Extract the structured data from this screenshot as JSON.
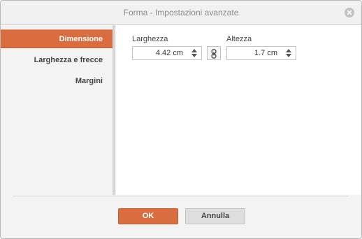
{
  "dialog": {
    "title": "Forma - Impostazioni avanzate"
  },
  "sidebar": {
    "items": [
      {
        "label": "Dimensione",
        "active": true
      },
      {
        "label": "Larghezza e frecce",
        "active": false
      },
      {
        "label": "Margini",
        "active": false
      }
    ]
  },
  "size": {
    "width_label": "Larghezza",
    "width_value": "4.42 cm",
    "height_label": "Altezza",
    "height_value": "1.7 cm",
    "aspect_lock_icon": "chain-link-icon"
  },
  "footer": {
    "ok_label": "OK",
    "cancel_label": "Annulla"
  },
  "colors": {
    "accent": "#d96d40",
    "title_text": "#8a8a8a"
  }
}
